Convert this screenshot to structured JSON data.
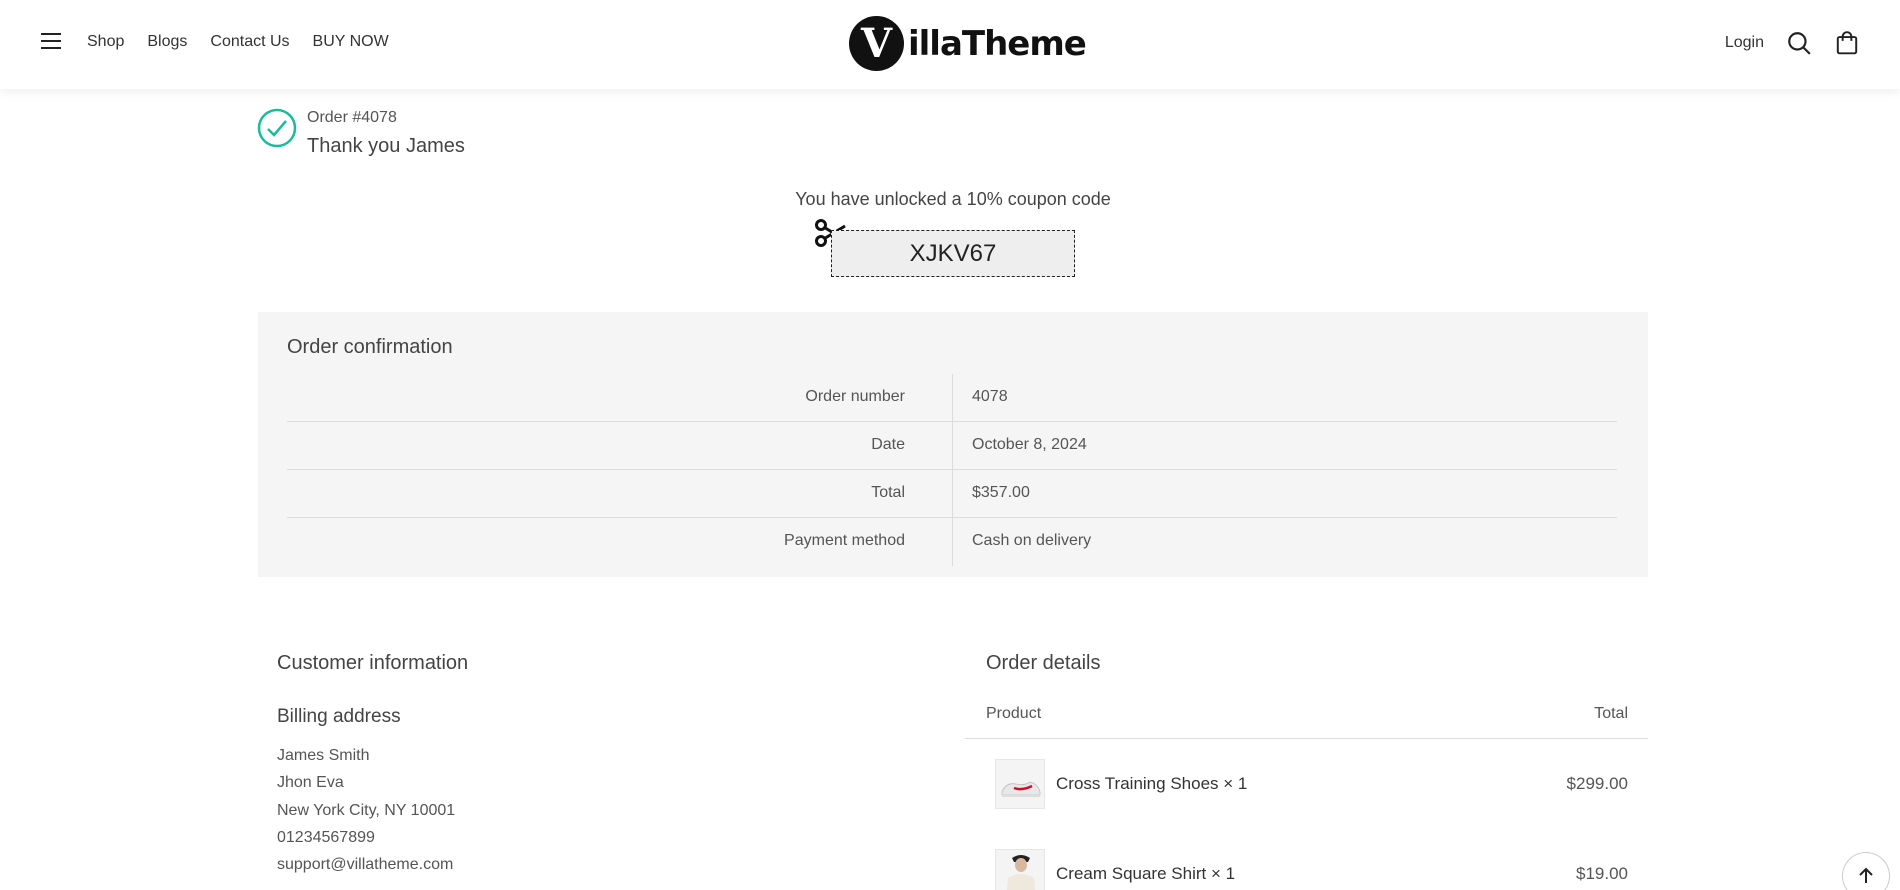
{
  "header": {
    "nav": [
      "Shop",
      "Blogs",
      "Contact Us",
      "BUY NOW"
    ],
    "logo_letter": "V",
    "logo_text": "illaTheme",
    "login_label": "Login"
  },
  "order": {
    "number_label": "Order #4078",
    "thanks": "Thank you James"
  },
  "coupon": {
    "message": "You have unlocked a 10% coupon code",
    "code": "XJKV67"
  },
  "confirmation": {
    "title": "Order confirmation",
    "rows": [
      {
        "label": "Order number",
        "value": "4078"
      },
      {
        "label": "Date",
        "value": "October 8, 2024"
      },
      {
        "label": "Total",
        "value": "$357.00"
      },
      {
        "label": "Payment method",
        "value": "Cash on delivery"
      }
    ]
  },
  "customer": {
    "title": "Customer information",
    "billing_title": "Billing address",
    "lines": [
      "James Smith",
      "Jhon Eva",
      "New York City, NY 10001",
      "01234567899",
      "support@villatheme.com"
    ]
  },
  "order_details": {
    "title": "Order details",
    "col_product": "Product",
    "col_total": "Total",
    "items": [
      {
        "name": "Cross Training Shoes × 1",
        "price": "$299.00"
      },
      {
        "name": "Cream Square Shirt × 1",
        "price": "$19.00"
      }
    ]
  },
  "colors": {
    "accent": "#1abc9c",
    "panel_bg": "#f5f5f5",
    "coupon_bg": "#eeeeee"
  },
  "icons": [
    "menu-icon",
    "search-icon",
    "cart-icon",
    "check-circle-icon",
    "scissors-icon",
    "arrow-up-icon"
  ]
}
